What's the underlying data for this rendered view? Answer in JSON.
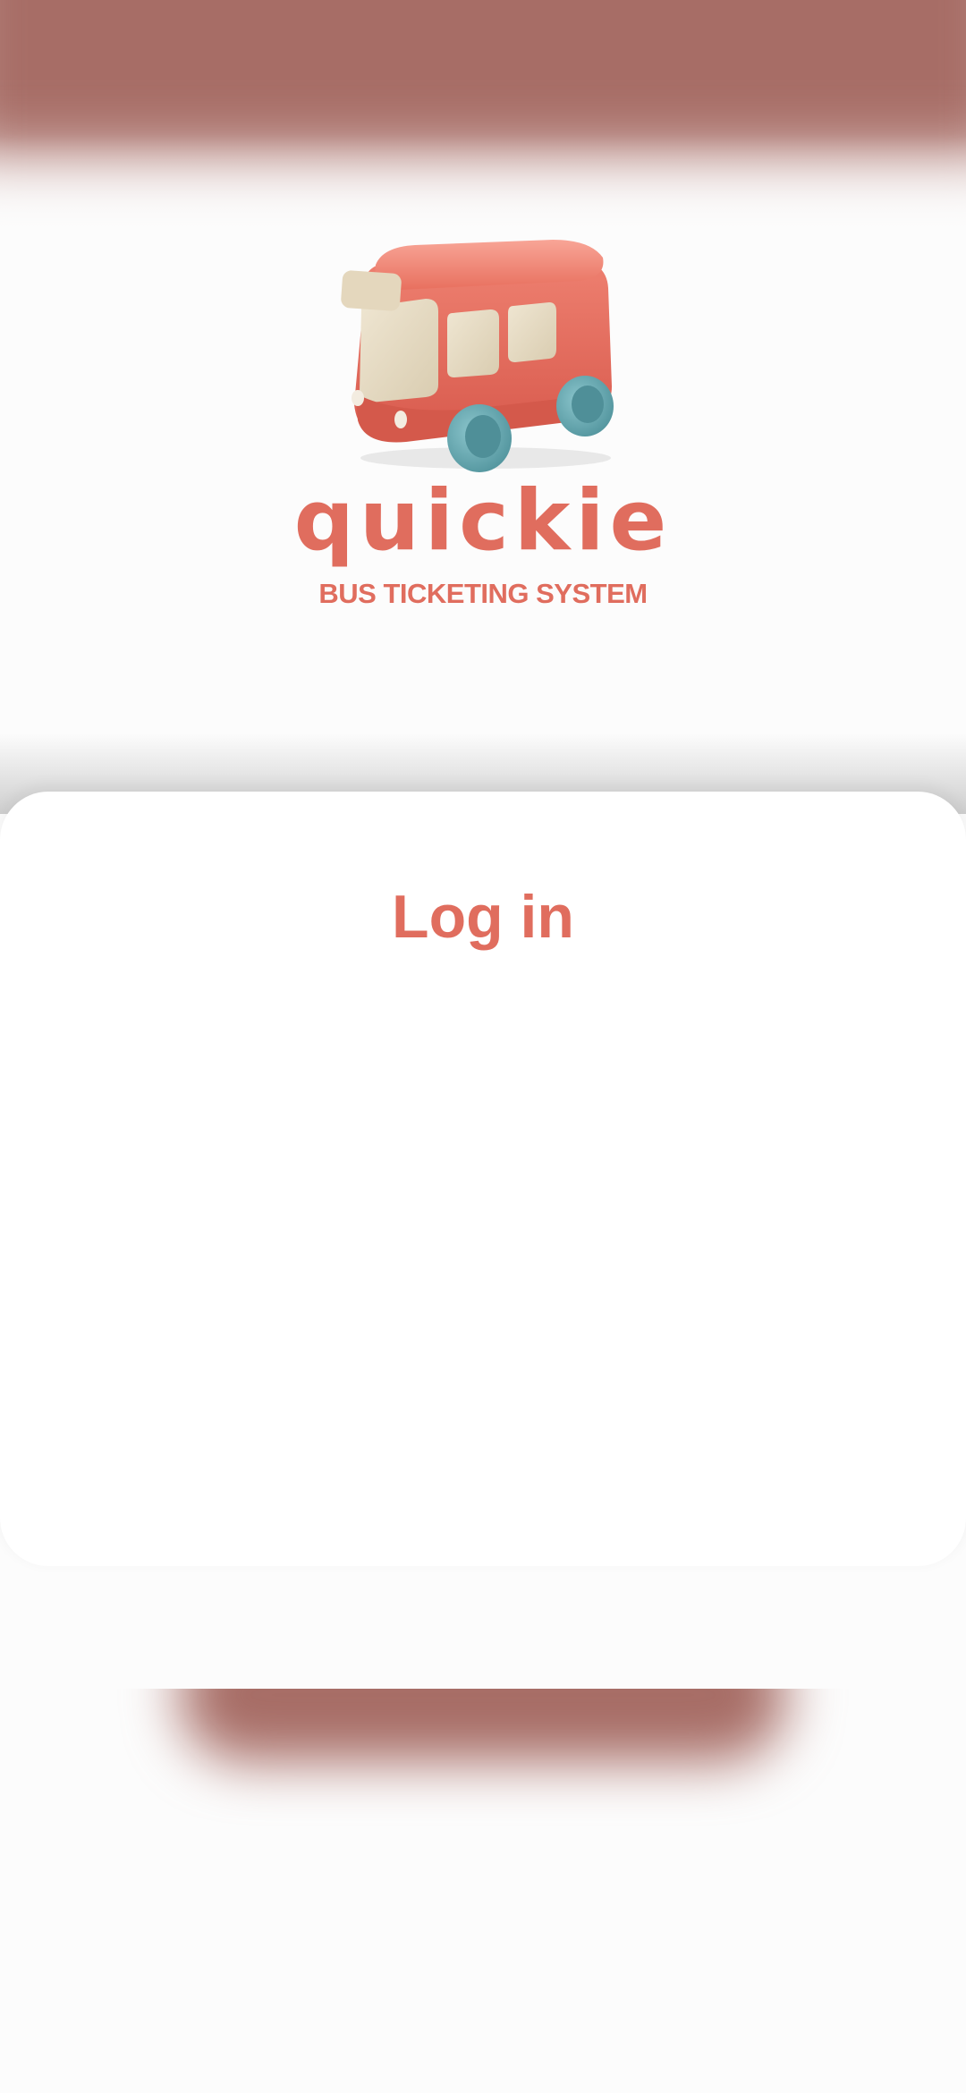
{
  "app": {
    "brand_name": "quickie",
    "tagline": "BUS TICKETING SYSTEM",
    "logo_icon": "bus-icon"
  },
  "login": {
    "title": "Log in"
  },
  "colors": {
    "accent": "#e06d5e",
    "header_glow": "#a76d66",
    "background": "#fcfcfc",
    "card": "#ffffff",
    "bus_body": "#e2675a",
    "bus_window": "#e6dcc5",
    "bus_wheel": "#6fb0b8"
  }
}
